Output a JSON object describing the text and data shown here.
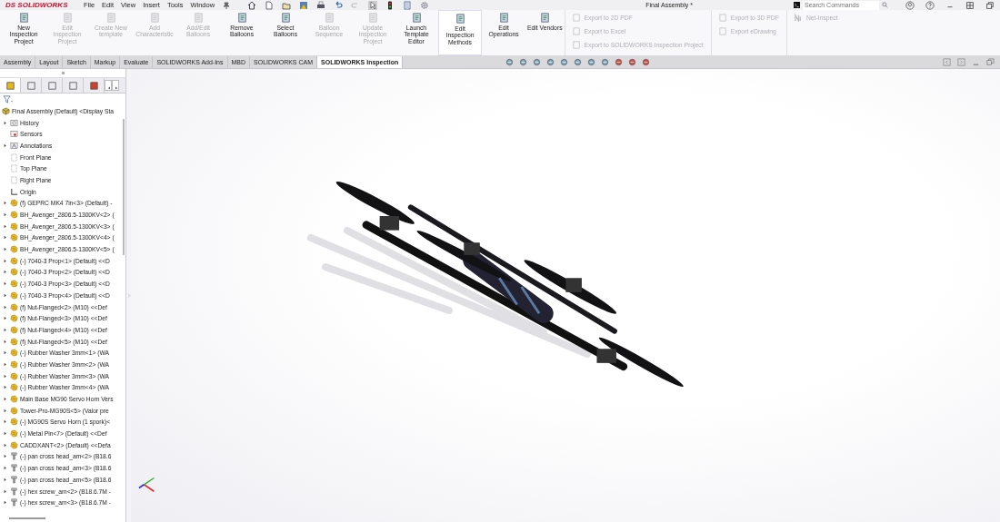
{
  "app": {
    "logo_mark": "DS",
    "logo": "SOLIDWORKS",
    "menu": [
      "File",
      "Edit",
      "View",
      "Insert",
      "Tools",
      "Window"
    ],
    "title": "Final Assembly *",
    "search": {
      "placeholder": "Search Commands"
    }
  },
  "ribbon": {
    "large": [
      {
        "label": "New Inspection Project",
        "disabled": false,
        "selected": false
      },
      {
        "label": "Edit Inspection Project",
        "disabled": true,
        "selected": false
      },
      {
        "label": "Create New template",
        "disabled": true,
        "selected": false
      },
      {
        "label": "Add Characteristic",
        "disabled": true,
        "selected": false
      },
      {
        "label": "Add/Edit Balloons",
        "disabled": true,
        "selected": false
      },
      {
        "label": "Remove Balloons",
        "disabled": false,
        "selected": false
      },
      {
        "label": "Select Balloons",
        "disabled": false,
        "selected": false
      },
      {
        "label": "Balloon Sequence",
        "disabled": true,
        "selected": false
      },
      {
        "label": "Update Inspection Project",
        "disabled": true,
        "selected": false
      },
      {
        "label": "Launch Template Editor",
        "disabled": false,
        "selected": false
      },
      {
        "label": "Edit Inspection Methods",
        "disabled": false,
        "selected": true
      },
      {
        "label": "Edit Operations",
        "disabled": false,
        "selected": false
      },
      {
        "label": "Edit Vendors",
        "disabled": false,
        "selected": false
      }
    ],
    "export_left": [
      {
        "label": "Export to 2D PDF",
        "disabled": true
      },
      {
        "label": "Export to Excel",
        "disabled": true
      },
      {
        "label": "Export to SOLIDWORKS Inspection Project",
        "disabled": true
      }
    ],
    "export_right": [
      {
        "label": "Export to 3D PDF",
        "disabled": true
      },
      {
        "label": "Export eDrawing",
        "disabled": true
      }
    ],
    "net_inspect": {
      "label": "Net-Inspect",
      "disabled": true
    }
  },
  "tabs": [
    {
      "label": "Assembly",
      "selected": false
    },
    {
      "label": "Layout",
      "selected": false
    },
    {
      "label": "Sketch",
      "selected": false
    },
    {
      "label": "Markup",
      "selected": false
    },
    {
      "label": "Evaluate",
      "selected": false
    },
    {
      "label": "SOLIDWORKS Add-Ins",
      "selected": false
    },
    {
      "label": "MBD",
      "selected": false
    },
    {
      "label": "SOLIDWORKS CAM",
      "selected": false
    },
    {
      "label": "SOLIDWORKS Inspection",
      "selected": true
    }
  ],
  "tree": {
    "label": "Final Assembly (Default) <Display Sta",
    "kind": "assembly",
    "children": [
      {
        "label": "History",
        "kind": "history",
        "expandable": true
      },
      {
        "label": "Sensors",
        "kind": "sensor",
        "expandable": false
      },
      {
        "label": "Annotations",
        "kind": "annotation",
        "expandable": true
      },
      {
        "label": "Front Plane",
        "kind": "plane",
        "expandable": false
      },
      {
        "label": "Top Plane",
        "kind": "plane",
        "expandable": false
      },
      {
        "label": "Right Plane",
        "kind": "plane",
        "expandable": false
      },
      {
        "label": "Origin",
        "kind": "origin",
        "expandable": false
      },
      {
        "label": "(f) GEPRC MK4 7in<3> (Default) -",
        "kind": "part",
        "expandable": true
      },
      {
        "label": "BH_Avenger_2806.5-1300KV<2> (",
        "kind": "part",
        "expandable": true
      },
      {
        "label": "BH_Avenger_2806.5-1300KV<3> (",
        "kind": "part",
        "expandable": true
      },
      {
        "label": "BH_Avenger_2806.5-1300KV<4> (",
        "kind": "part",
        "expandable": true
      },
      {
        "label": "BH_Avenger_2806.5-1300KV<5> (",
        "kind": "part",
        "expandable": true
      },
      {
        "label": "(-) 7040-3 Prop<1> (Default) <<D",
        "kind": "part",
        "expandable": true
      },
      {
        "label": "(-) 7040-3 Prop<2> (Default) <<D",
        "kind": "part",
        "expandable": true
      },
      {
        "label": "(-) 7040-3 Prop<3> (Default) <<D",
        "kind": "part",
        "expandable": true
      },
      {
        "label": "(-) 7040-3 Prop<4> (Default) <<D",
        "kind": "part",
        "expandable": true
      },
      {
        "label": "(f) Nut-Flanged<2> (M10) <<Def",
        "kind": "part",
        "expandable": true
      },
      {
        "label": "(f) Nut-Flanged<3> (M10) <<Def",
        "kind": "part",
        "expandable": true
      },
      {
        "label": "(f) Nut-Flanged<4> (M10) <<Def",
        "kind": "part",
        "expandable": true
      },
      {
        "label": "(f) Nut-Flanged<5> (M10) <<Def",
        "kind": "part",
        "expandable": true
      },
      {
        "label": "(-) Rubber Washer 3mm<1> (WA",
        "kind": "part",
        "expandable": true
      },
      {
        "label": "(-) Rubber Washer 3mm<2> (WA",
        "kind": "part",
        "expandable": true
      },
      {
        "label": "(-) Rubber Washer 3mm<3> (WA",
        "kind": "part",
        "expandable": true
      },
      {
        "label": "(-) Rubber Washer 3mm<4> (WA",
        "kind": "part",
        "expandable": true
      },
      {
        "label": "Main Base MG90 Servo Horn Vers",
        "kind": "part",
        "expandable": true
      },
      {
        "label": "Tower-Pro-MG90S<5> (Valor pre",
        "kind": "part",
        "expandable": true
      },
      {
        "label": "(-) MG90S Servo Horn (1 spork)<",
        "kind": "part",
        "expandable": true
      },
      {
        "label": "(-) Metal Pin<7> (Default) <<Def",
        "kind": "part",
        "expandable": true
      },
      {
        "label": "CADDXANT<2> (Default) <<Defa",
        "kind": "part",
        "expandable": true
      },
      {
        "label": "(-) pan cross head_am<2> (B18.6",
        "kind": "screw",
        "expandable": true
      },
      {
        "label": "(-) pan cross head_am<3> (B18.6",
        "kind": "screw",
        "expandable": true
      },
      {
        "label": "(-) pan cross head_am<5> (B18.6",
        "kind": "screw",
        "expandable": true
      },
      {
        "label": "(-) hex screw_am<2> (B18.6.7M -",
        "kind": "screw",
        "expandable": true
      },
      {
        "label": "(-) hex screw_am<3> (B18.6.7M -",
        "kind": "screw",
        "expandable": true
      }
    ]
  }
}
